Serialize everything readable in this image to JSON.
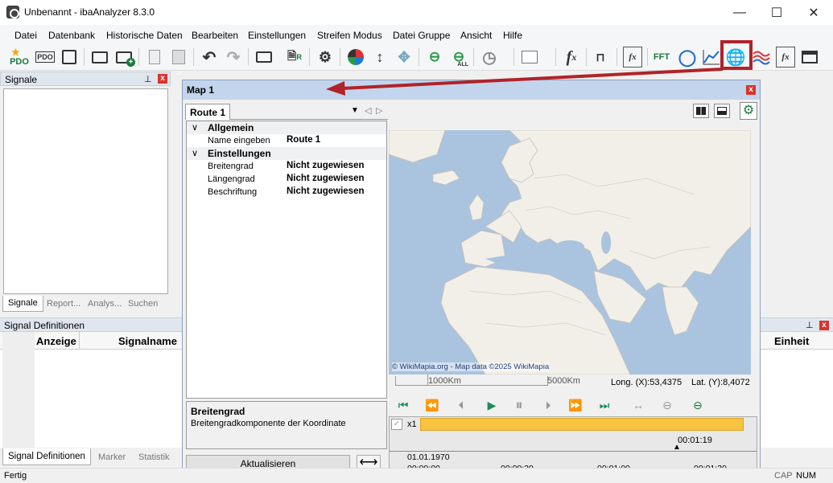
{
  "window": {
    "title": "Unbenannt - ibaAnalyzer 8.3.0",
    "minimize": "—",
    "maximize": "☐",
    "close": "✕"
  },
  "menu": [
    "Datei",
    "Datenbank",
    "Historische Daten",
    "Bearbeiten",
    "Einstellungen",
    "Streifen Modus",
    "Datei Gruppe",
    "Ansicht",
    "Hilfe"
  ],
  "toolbar": {
    "pdo1": "PDO",
    "pdo2": "PDO",
    "fft": "FFT",
    "fx": "fx",
    "all": "ALL"
  },
  "signals_panel": {
    "title": "Signale",
    "tabs": [
      "Signale",
      "Report...",
      "Analys...",
      "Suchen"
    ]
  },
  "sigdef_panel": {
    "title": "Signal Definitionen",
    "col_anzeige": "Anzeige",
    "col_signalname": "Signalname",
    "col_einheit": "Einheit",
    "tabs": [
      "Signal Definitionen",
      "Marker",
      "Statistik"
    ]
  },
  "map": {
    "title": "Map 1",
    "route_tab": "Route 1",
    "groups": {
      "allgemein": "Allgemein",
      "einstellungen": "Einstellungen"
    },
    "rows": [
      {
        "label": "Name eingeben",
        "value": "Route 1"
      },
      {
        "label": "Breitengrad",
        "value": "Nicht zugewiesen"
      },
      {
        "label": "Längengrad",
        "value": "Nicht zugewiesen"
      },
      {
        "label": "Beschriftung",
        "value": "Nicht zugewiesen"
      }
    ],
    "desc_title": "Breitengrad",
    "desc_text": "Breitengradkomponente der Koordinate",
    "update_button": "Aktualisieren",
    "attribution": "© WikiMapia.org - Map data ©2025 WikiMapia",
    "scale1": "1000Km",
    "scale2": "5000Km",
    "long": "Long. (X):53,4375",
    "lat": "Lat. (Y):8,4072",
    "zoom_label": "x1",
    "time_cursor": "00:01:19",
    "date": "01.01.1970",
    "ticks": [
      "00:00:00",
      "00:00:30",
      "00:01:00",
      "00:01:30"
    ]
  },
  "statusbar": {
    "text": "Fertig",
    "cap": "CAP",
    "num": "NUM"
  },
  "colors": {
    "accent_red": "#b0232a",
    "map_water": "#aac3df",
    "map_land": "#f2efe9",
    "timeline": "#f6c440"
  }
}
